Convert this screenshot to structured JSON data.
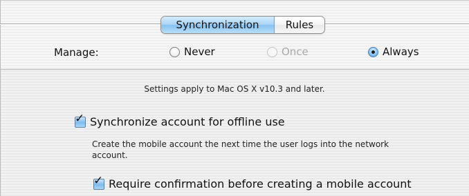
{
  "tabs": {
    "items": [
      {
        "label": "Synchronization",
        "selected": true
      },
      {
        "label": "Rules",
        "selected": false
      }
    ]
  },
  "manage": {
    "label": "Manage:",
    "options": [
      {
        "label": "Never",
        "state": "unselected"
      },
      {
        "label": "Once",
        "state": "disabled"
      },
      {
        "label": "Always",
        "state": "selected"
      }
    ]
  },
  "note": "Settings apply to Mac OS X v10.3 and later.",
  "sync": {
    "label": "Synchronize account for offline use",
    "checked": true,
    "description": "Create the mobile account the next time the user logs into the network account."
  },
  "confirm": {
    "label": "Require confirmation before creating a mobile account",
    "checked": true
  },
  "colors": {
    "accent": "#86c1ef",
    "disabled_text": "#a9a9a9"
  }
}
